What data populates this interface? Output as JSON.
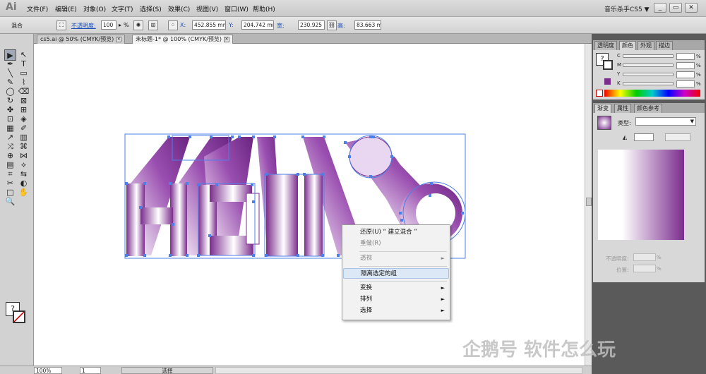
{
  "app": {
    "logo": "Ai",
    "workspace": "音乐杀手CS5 ▼",
    "menus": [
      "文件(F)",
      "编辑(E)",
      "对象(O)",
      "文字(T)",
      "选择(S)",
      "效果(C)",
      "视图(V)",
      "窗口(W)",
      "帮助(H)"
    ],
    "win_buttons": [
      "_",
      "▭",
      "✕"
    ]
  },
  "control": {
    "mode": "混合",
    "opacity_label": "不透明度:",
    "opacity_value": "100",
    "opacity_unit": "%",
    "x_label": "X:",
    "x_value": "452.855 mm",
    "y_label": "Y:",
    "y_value": "204.742 mm",
    "w_label": "宽:",
    "w_value": "230.925 mm",
    "h_label": "高:",
    "h_value": "83.663 mm"
  },
  "tabs": [
    {
      "label": "cs5.ai @ 50% (CMYK/预览)",
      "close": "✕"
    },
    {
      "label": "未标题-1* @ 100% (CMYK/预览)",
      "close": "✕"
    }
  ],
  "tools": [
    "▶",
    "↖",
    "✒",
    "T",
    "╲",
    "▭",
    "✎",
    "⌇",
    "◯",
    "⌫",
    "↻",
    "⊠",
    "✤",
    "⊞",
    "⊡",
    "◈",
    "▦",
    "✐",
    "↗",
    "▥",
    "⤨",
    "⌘",
    "⊕",
    "⋈",
    "▤",
    "⟡",
    "⌗",
    "⇆",
    "✂",
    "◐",
    "□",
    "✋",
    "🔍"
  ],
  "canvas": {
    "accent": "#7b2d8e",
    "selection_color": "#4d7fe8"
  },
  "context_menu": [
    {
      "label": "还原(U) “ 建立混合 ”",
      "disabled": false,
      "sub": ""
    },
    {
      "label": "重做(R)",
      "disabled": true,
      "sub": ""
    },
    {
      "sep": true
    },
    {
      "label": "透视",
      "disabled": true,
      "sub": "►"
    },
    {
      "sep": true
    },
    {
      "label": "隔离选定的组",
      "disabled": false,
      "sub": "",
      "highlight": true
    },
    {
      "sep": true
    },
    {
      "label": "变换",
      "disabled": false,
      "sub": "►"
    },
    {
      "label": "排列",
      "disabled": false,
      "sub": "►"
    },
    {
      "label": "选择",
      "disabled": false,
      "sub": "►"
    }
  ],
  "status": {
    "zoom": "100%",
    "page": "1",
    "mode": "选择"
  },
  "color_panel": {
    "tabs": [
      "透明度",
      "颜色",
      "外观",
      "描边"
    ],
    "channels": [
      "C",
      "M",
      "Y",
      "K"
    ],
    "unit": "%"
  },
  "gradient_panel": {
    "tabs": [
      "渐变",
      "属性",
      "颜色参考"
    ],
    "type_label": "类型:",
    "opacity_label": "不透明度:",
    "position_label": "位置:",
    "unit": "%"
  },
  "watermark": "企鹅号 软件怎么玩"
}
